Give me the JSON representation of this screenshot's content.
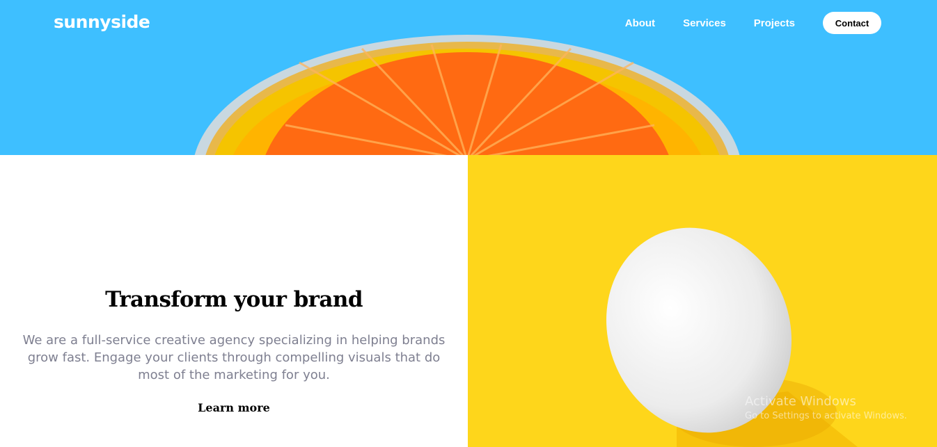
{
  "header": {
    "logo": "sunnyside",
    "nav": {
      "about": "About",
      "services": "Services",
      "projects": "Projects",
      "contact": "Contact"
    }
  },
  "feature": {
    "headline": "Transform your brand",
    "description": "We are a full-service creative agency specializing in helping brands grow fast. Engage your clients through compelling visuals that do most of the marketing for you.",
    "cta": "Learn more"
  },
  "watermark": {
    "title": "Activate Windows",
    "subtitle": "Go to Settings to activate Windows."
  },
  "colors": {
    "header_bg": "#3ebfff",
    "egg_bg": "#fed61b",
    "underline": "#f2c721",
    "body_text": "#7e7f90"
  }
}
